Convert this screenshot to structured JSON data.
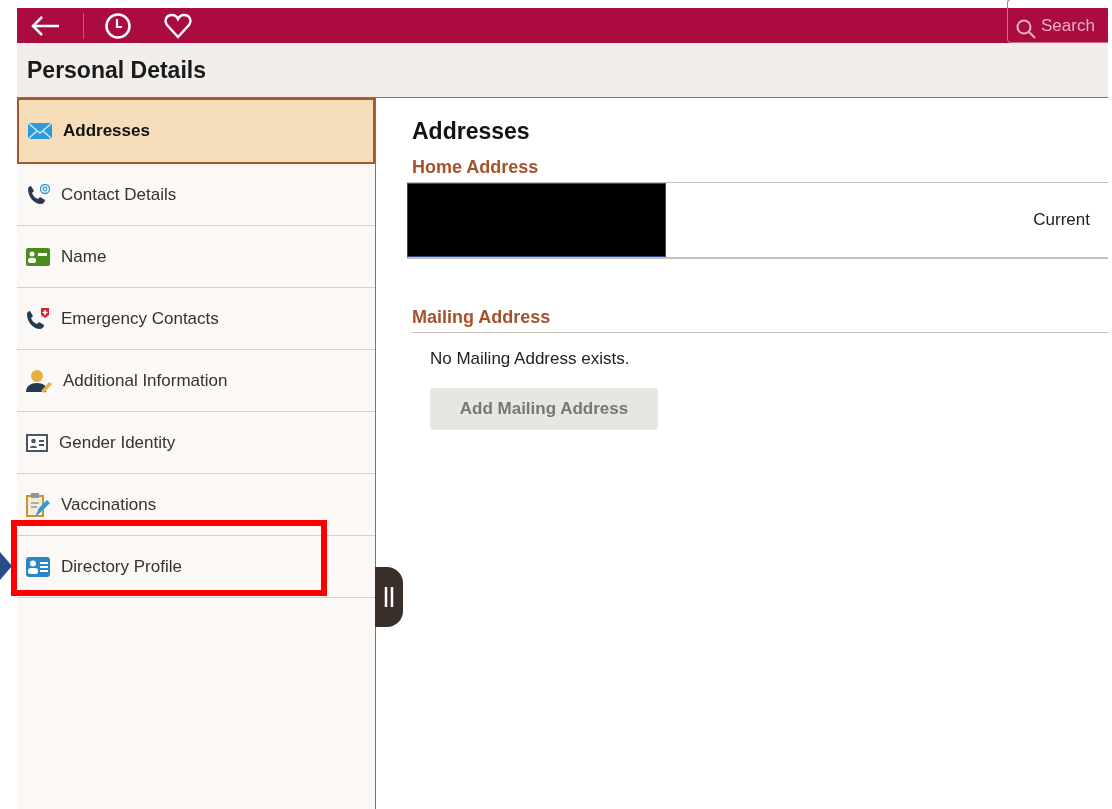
{
  "toolbar": {
    "search": {
      "placeholder": "Search"
    }
  },
  "page_title": "Personal Details",
  "sidebar": {
    "items": [
      {
        "label": "Addresses",
        "selected": true
      },
      {
        "label": "Contact Details",
        "selected": false
      },
      {
        "label": "Name",
        "selected": false
      },
      {
        "label": "Emergency Contacts",
        "selected": false
      },
      {
        "label": "Additional Information",
        "selected": false
      },
      {
        "label": "Gender Identity",
        "selected": false
      },
      {
        "label": "Vaccinations",
        "selected": false
      },
      {
        "label": "Directory Profile",
        "selected": false,
        "highlighted": true
      }
    ]
  },
  "content": {
    "title": "Addresses",
    "home_address": {
      "heading": "Home Address",
      "redacted": true,
      "status": "Current"
    },
    "mailing_address": {
      "heading": "Mailing Address",
      "message": "No Mailing Address exists.",
      "button": {
        "label": "Add Mailing Address",
        "disabled": true
      }
    }
  }
}
